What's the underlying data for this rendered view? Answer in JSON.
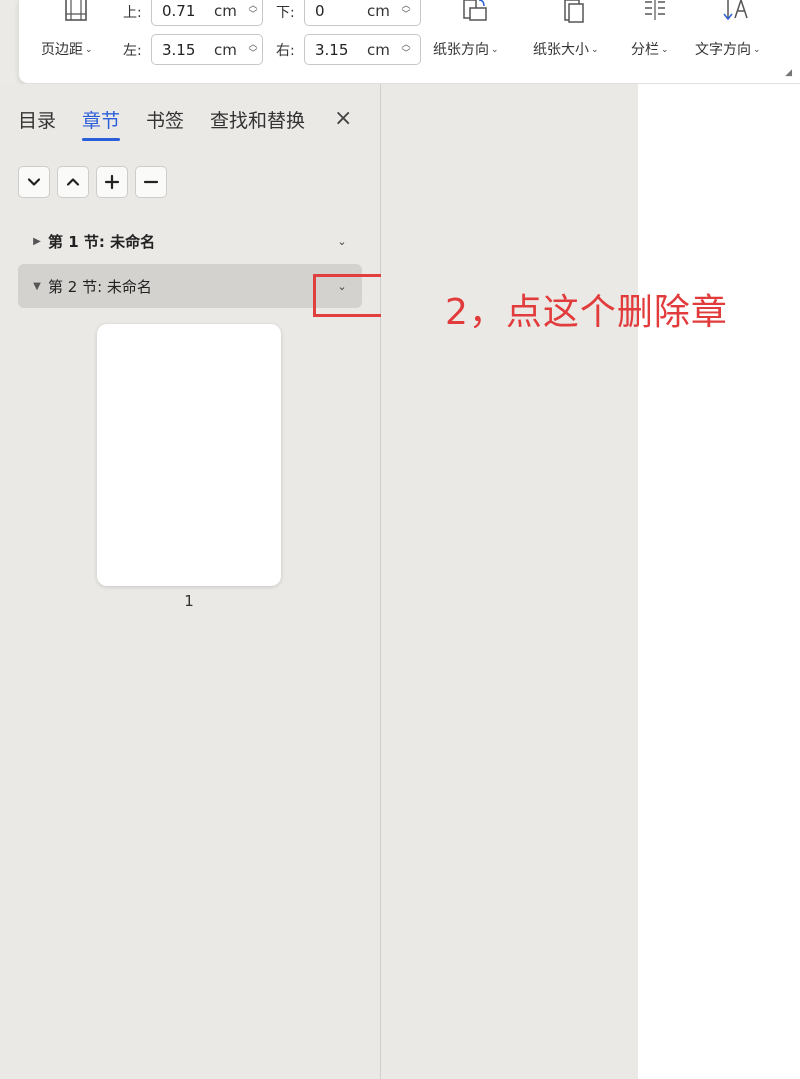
{
  "ribbon": {
    "margins_label": "页边距",
    "top_label": "上:",
    "top_value": "0.71",
    "top_unit": "cm",
    "bottom_label": "下:",
    "bottom_value": "0",
    "bottom_unit": "cm",
    "left_label": "左:",
    "left_value": "3.15",
    "left_unit": "cm",
    "right_label": "右:",
    "right_value": "3.15",
    "right_unit": "cm",
    "orientation_label": "纸张方向",
    "size_label": "纸张大小",
    "columns_label": "分栏",
    "text_direction_label": "文字方向",
    "icons": [
      "page-margins-icon",
      "orientation-icon",
      "paper-size-icon",
      "columns-icon",
      "text-direction-icon"
    ]
  },
  "pane": {
    "tabs": [
      {
        "label": "目录",
        "active": false
      },
      {
        "label": "章节",
        "active": true
      },
      {
        "label": "书签",
        "active": false
      },
      {
        "label": "查找和替换",
        "active": false
      }
    ],
    "close_icon": "×",
    "nav_buttons": [
      "chevron-down-icon",
      "chevron-up-icon",
      "plus-icon",
      "minus-icon"
    ],
    "sections": [
      {
        "title": "第 1 节: 未命名",
        "expanded": false,
        "selected": false
      },
      {
        "title": "第 2 节: 未命名",
        "expanded": true,
        "selected": true
      }
    ],
    "page_number": "1"
  },
  "annotation": "2，点这个删除章",
  "colors": {
    "accent": "#2b5fd9",
    "annotation_red": "#e23b3b",
    "pane_bg": "#ebe9e6",
    "selected_row_bg": "#d4d2cf"
  }
}
